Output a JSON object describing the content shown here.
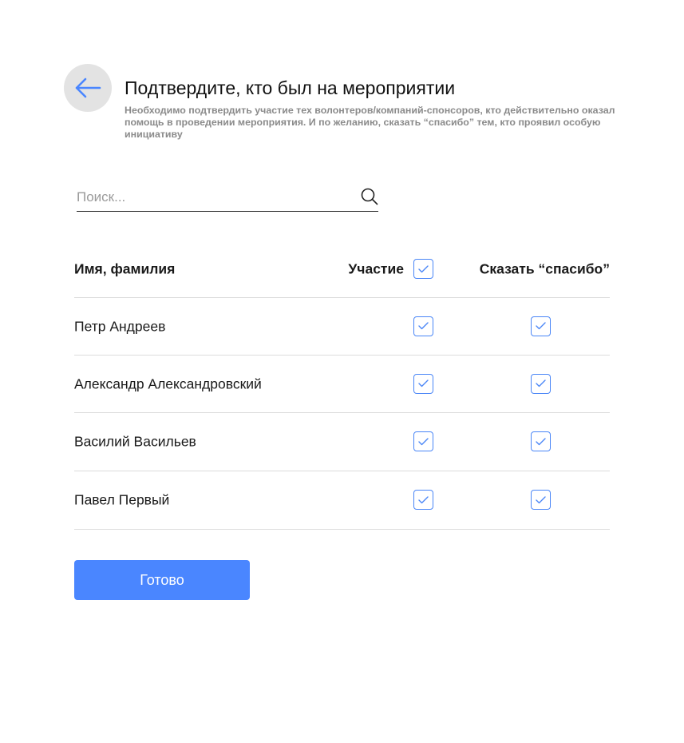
{
  "header": {
    "title": "Подтвердите, кто был на мероприятии",
    "subtitle": "Необходимо подтвердить участие тех волонтеров/компаний-спонсоров, кто действительно оказал помощь в проведении мероприятия. И по желанию, сказать “спасибо” тем, кто проявил особую инициативу",
    "back_icon": "arrow-left-icon"
  },
  "search": {
    "placeholder": "Поиск...",
    "value": "",
    "icon": "search-icon"
  },
  "table": {
    "columns": {
      "name": "Имя, фамилия",
      "participation": "Участие",
      "thanks": "Сказать “спасибо”"
    },
    "select_all_participation": true,
    "rows": [
      {
        "name": "Петр Андреев",
        "participation": true,
        "thanks": true
      },
      {
        "name": "Александр Александровский",
        "participation": true,
        "thanks": true
      },
      {
        "name": "Василий Васильев",
        "participation": true,
        "thanks": true
      },
      {
        "name": "Павел Первый",
        "participation": true,
        "thanks": true
      }
    ]
  },
  "actions": {
    "done_label": "Готово"
  },
  "colors": {
    "accent": "#4a86ff",
    "back_button_bg": "#e3e3e3",
    "subtitle_text": "#8a8a8a",
    "divider": "#dcdcdc"
  }
}
